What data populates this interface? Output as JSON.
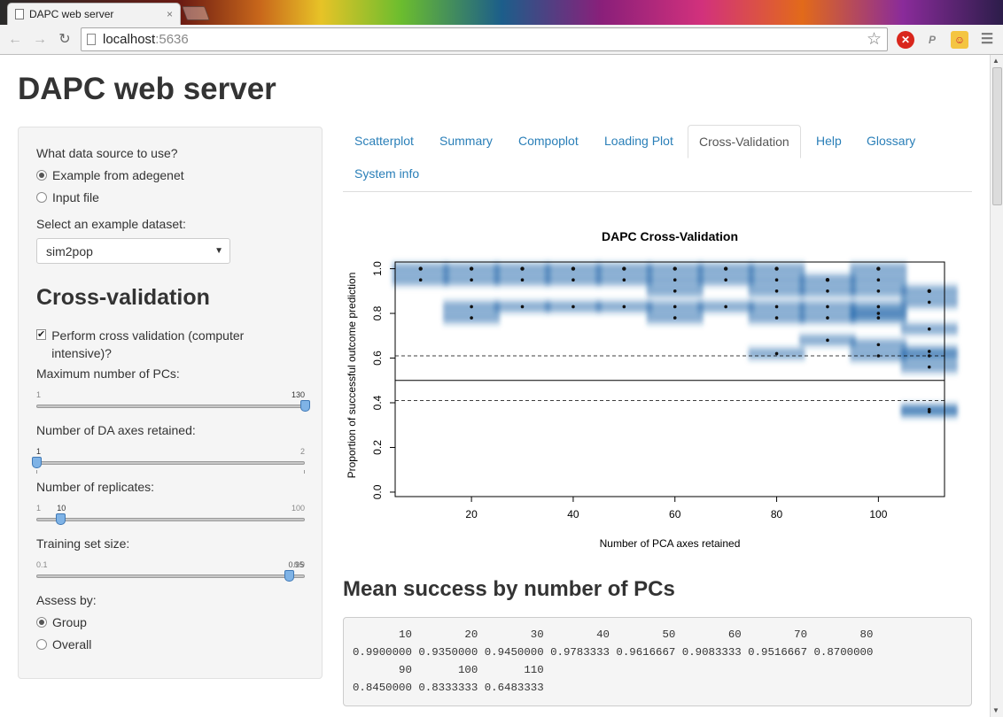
{
  "browser": {
    "tab_title": "DAPC web server",
    "tab_close": "×",
    "url_host": "localhost",
    "url_port": ":5636",
    "star_icon": "☆"
  },
  "page": {
    "title": "DAPC web server"
  },
  "sidebar": {
    "data_source_label": "What data source to use?",
    "data_source_options": [
      {
        "label": "Example from adegenet",
        "selected": true
      },
      {
        "label": "Input file",
        "selected": false
      }
    ],
    "example_dataset_label": "Select an example dataset:",
    "example_dataset_value": "sim2pop",
    "cv_heading": "Cross-validation",
    "perform_cv_label": "Perform cross validation (computer intensive)?",
    "perform_cv_checked": true,
    "sliders": {
      "max_pcs": {
        "label": "Maximum number of PCs:",
        "min": "1",
        "max": "",
        "value": "130",
        "fraction": 1.0
      },
      "da_axes": {
        "label": "Number of DA axes retained:",
        "min": "",
        "max": "2",
        "value": "1",
        "fraction": 0.0
      },
      "replicates": {
        "label": "Number of replicates:",
        "min": "1",
        "max": "100",
        "value": "10",
        "fraction": 0.09
      },
      "training": {
        "label": "Training set size:",
        "min": "0.1",
        "max": "",
        "value": "0.95",
        "value_overlap": "0.9",
        "fraction": 0.94
      }
    },
    "assess_label": "Assess by:",
    "assess_options": [
      {
        "label": "Group",
        "selected": true
      },
      {
        "label": "Overall",
        "selected": false
      }
    ]
  },
  "tabs": [
    {
      "label": "Scatterplot",
      "active": false
    },
    {
      "label": "Summary",
      "active": false
    },
    {
      "label": "Compoplot",
      "active": false
    },
    {
      "label": "Loading Plot",
      "active": false
    },
    {
      "label": "Cross-Validation",
      "active": true
    },
    {
      "label": "Help",
      "active": false
    },
    {
      "label": "Glossary",
      "active": false
    },
    {
      "label": "System info",
      "active": false
    }
  ],
  "chart_data": {
    "type": "scatter",
    "title": "DAPC Cross-Validation",
    "xlabel": "Number of PCA axes retained",
    "ylabel": "Proportion of successful outcome prediction",
    "xlim": [
      5,
      113
    ],
    "ylim": [
      -0.02,
      1.03
    ],
    "x_ticks": [
      "20",
      "40",
      "60",
      "80",
      "100"
    ],
    "y_ticks": [
      "0.0",
      "0.2",
      "0.4",
      "0.6",
      "0.8",
      "1.0"
    ],
    "reference_lines": {
      "solid": 0.5,
      "dashed": [
        0.41,
        0.61
      ]
    },
    "colors": {
      "density": "#2166ac",
      "points": "#111111"
    },
    "points": [
      {
        "x": 10,
        "y": [
          1.0,
          0.95
        ]
      },
      {
        "x": 20,
        "y": [
          1.0,
          0.95,
          0.83,
          0.78
        ]
      },
      {
        "x": 30,
        "y": [
          1.0,
          0.95,
          0.83
        ]
      },
      {
        "x": 40,
        "y": [
          1.0,
          0.95,
          0.83
        ]
      },
      {
        "x": 50,
        "y": [
          1.0,
          0.95,
          0.83
        ]
      },
      {
        "x": 60,
        "y": [
          1.0,
          0.95,
          0.9,
          0.83,
          0.78
        ]
      },
      {
        "x": 70,
        "y": [
          1.0,
          0.95,
          0.83
        ]
      },
      {
        "x": 80,
        "y": [
          1.0,
          0.95,
          0.9,
          0.83,
          0.78,
          0.62
        ]
      },
      {
        "x": 90,
        "y": [
          0.95,
          0.9,
          0.83,
          0.78,
          0.68
        ]
      },
      {
        "x": 100,
        "y": [
          1.0,
          0.95,
          0.9,
          0.83,
          0.8,
          0.78,
          0.66,
          0.61
        ]
      },
      {
        "x": 110,
        "y": [
          0.9,
          0.85,
          0.73,
          0.63,
          0.61,
          0.56,
          0.37,
          0.36
        ]
      }
    ]
  },
  "results": {
    "heading": "Mean success by number of PCs",
    "output": "       10        20        30        40        50        60        70        80 \n0.9900000 0.9350000 0.9450000 0.9783333 0.9616667 0.9083333 0.9516667 0.8700000 \n       90       100       110 \n0.8450000 0.8333333 0.6483333 "
  }
}
